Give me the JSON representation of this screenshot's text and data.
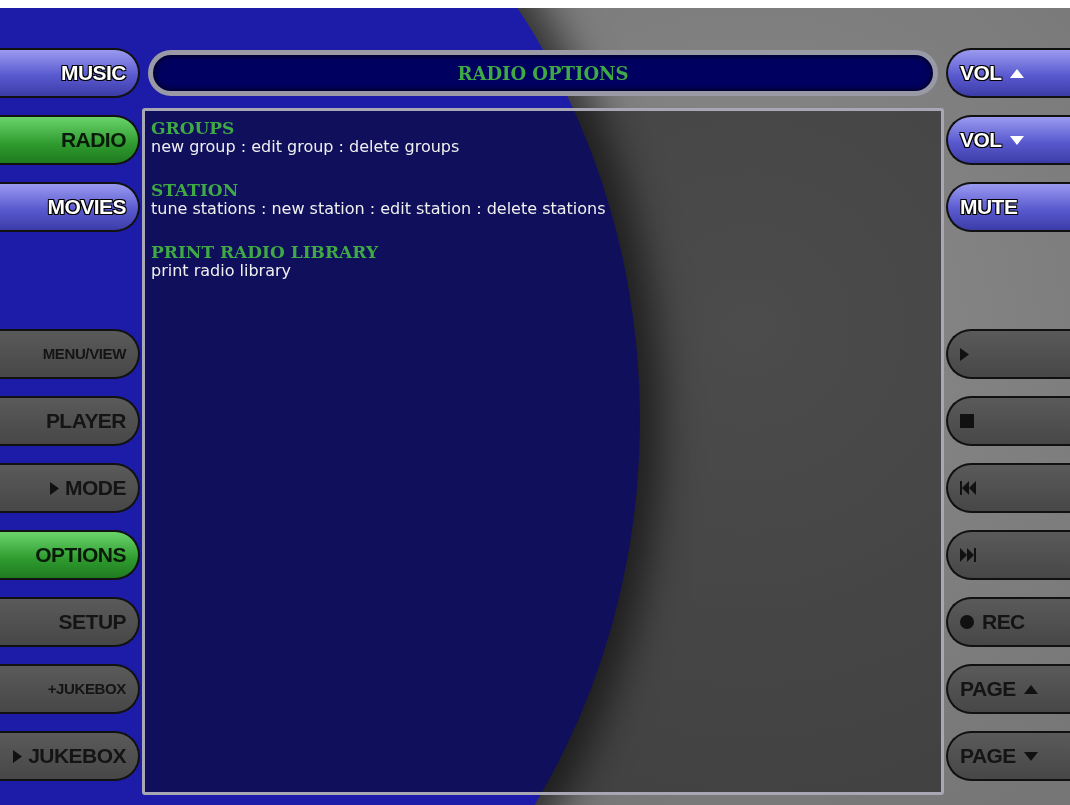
{
  "title": "RADIO OPTIONS",
  "left_top": [
    {
      "label": "MUSIC",
      "selected": false
    },
    {
      "label": "RADIO",
      "selected": true
    },
    {
      "label": "MOVIES",
      "selected": false
    }
  ],
  "left_bottom": [
    {
      "label": "MENU/VIEW",
      "kind": "text",
      "selected": false
    },
    {
      "label": "PLAYER",
      "kind": "text",
      "selected": false
    },
    {
      "label": "MODE",
      "kind": "arrow",
      "selected": false
    },
    {
      "label": "OPTIONS",
      "kind": "text",
      "selected": true
    },
    {
      "label": "SETUP",
      "kind": "text",
      "selected": false
    },
    {
      "label": "+JUKEBOX",
      "kind": "text",
      "selected": false
    },
    {
      "label": "JUKEBOX",
      "kind": "arrow",
      "selected": false
    }
  ],
  "sections": [
    {
      "heading": "GROUPS",
      "actions": "new group : edit group : delete groups"
    },
    {
      "heading": "STATION",
      "actions": "tune stations : new station : edit station : delete stations"
    },
    {
      "heading": "PRINT RADIO LIBRARY",
      "actions": "print radio library"
    }
  ],
  "right_top": [
    {
      "label": "VOL",
      "kind": "raise"
    },
    {
      "label": "VOL",
      "kind": "lower"
    },
    {
      "label": "MUTE",
      "kind": "text"
    }
  ],
  "right_bottom": [
    {
      "kind": "play"
    },
    {
      "kind": "stop"
    },
    {
      "kind": "previous"
    },
    {
      "kind": "next"
    },
    {
      "label": "REC",
      "kind": "record"
    },
    {
      "label": "PAGE",
      "kind": "raise"
    },
    {
      "label": "PAGE",
      "kind": "lower"
    }
  ]
}
